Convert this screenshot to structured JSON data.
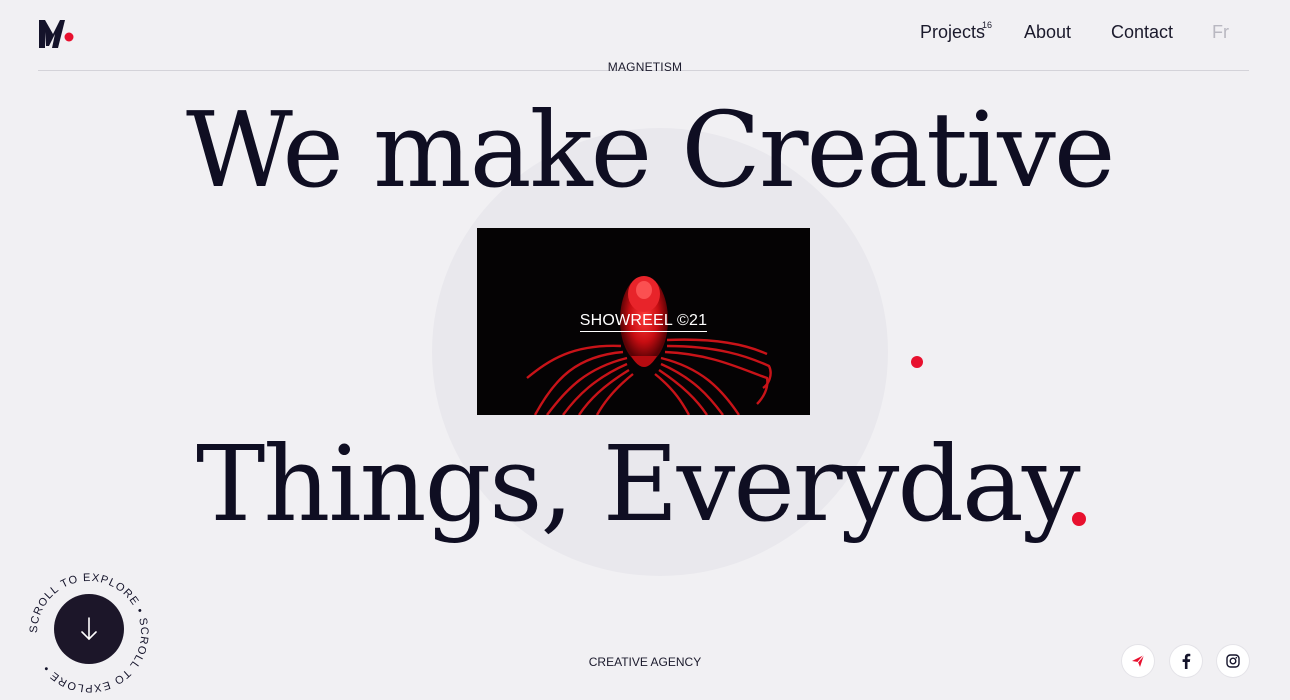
{
  "header": {
    "logo_icon": "magnetism-logo-icon",
    "nav": {
      "projects_label": "Projects",
      "projects_count": "16",
      "about_label": "About",
      "contact_label": "Contact",
      "language_label": "Fr"
    },
    "brand_caption": "MAGNETISM"
  },
  "hero": {
    "headline_line1": "We make Creative",
    "headline_line2": "Things, Everyday",
    "accent_color": "#e8102e"
  },
  "showreel": {
    "label": "SHOWREEL ©21"
  },
  "scroll": {
    "label": "SCROLL TO EXPLORE • SCROLL TO EXPLORE •",
    "icon": "arrow-down-icon"
  },
  "footer": {
    "caption": "CREATIVE AGENCY",
    "social_icons": [
      "send-icon",
      "facebook-icon",
      "instagram-icon"
    ]
  }
}
